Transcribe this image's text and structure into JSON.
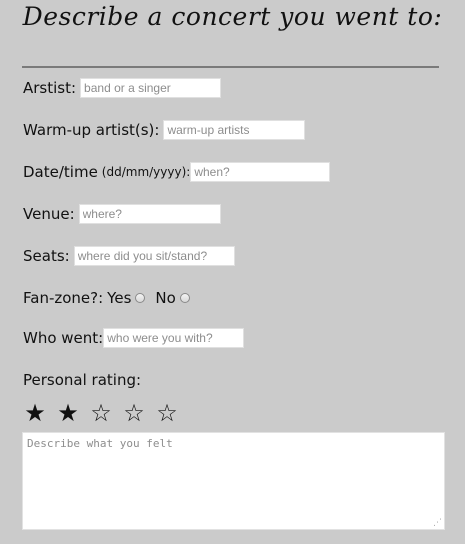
{
  "form": {
    "title": "Describe a concert you went to:",
    "artist": {
      "label": "Arstist:",
      "placeholder": "band or a singer"
    },
    "warmup": {
      "label": "Warm-up artist(s):",
      "placeholder": "warm-up artists"
    },
    "date": {
      "label": "Date/time",
      "format": "(dd/mm/yyyy):",
      "placeholder": "when?"
    },
    "venue": {
      "label": "Venue:",
      "placeholder": "where?"
    },
    "seats": {
      "label": "Seats:",
      "placeholder": "where did you sit/stand?"
    },
    "fanzone": {
      "label": "Fan-zone?:",
      "yes": "Yes",
      "no": "No"
    },
    "who": {
      "label": "Who went:",
      "placeholder": "who were you with?"
    },
    "rating": {
      "label": "Personal rating:",
      "value": 2,
      "max": 5,
      "stars": [
        "★",
        "★",
        "☆",
        "☆",
        "☆"
      ]
    },
    "description": {
      "placeholder": "Describe what you felt"
    }
  }
}
